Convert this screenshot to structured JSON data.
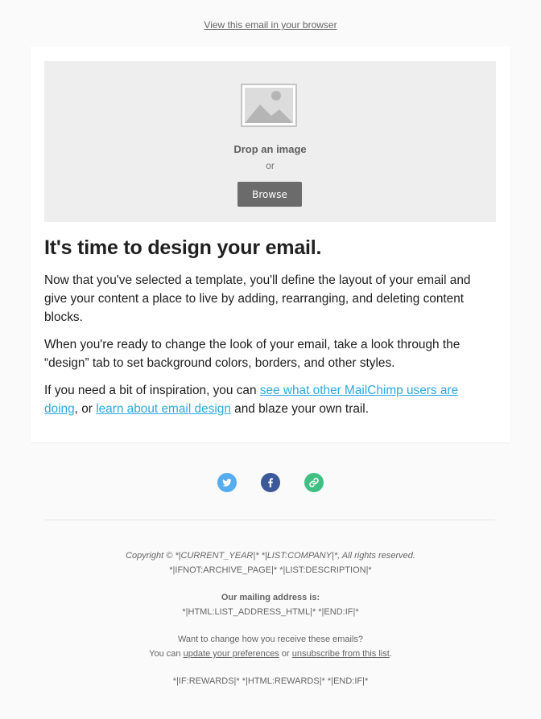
{
  "preheader": {
    "link": "View this email in your browser"
  },
  "dropzone": {
    "icon": "image-placeholder-icon",
    "drop_text": "Drop an image",
    "or_text": "or",
    "browse_label": "Browse"
  },
  "content": {
    "heading": "It's time to design your email.",
    "para1": "Now that you've selected a template, you'll define the layout of your email and give your content a place to live by adding, rearranging, and deleting content blocks.",
    "para2": "When you're ready to change the look of your email, take a look through the “design” tab to set background colors, borders, and other styles.",
    "para3_prefix": "If you need a bit of inspiration, you can ",
    "para3_link1": "see what other MailChimp users are doing",
    "para3_mid": ", or ",
    "para3_link2": "learn about email design",
    "para3_suffix": " and blaze your own trail."
  },
  "social": [
    {
      "name": "twitter-icon",
      "color": "#55acee"
    },
    {
      "name": "facebook-icon",
      "color": "#3b5998"
    },
    {
      "name": "link-icon",
      "color": "#3fbf83"
    }
  ],
  "footer": {
    "copyright": "Copyright © *|CURRENT_YEAR|* *|LIST:COMPANY|*, All rights reserved.",
    "description": "*|IFNOT:ARCHIVE_PAGE|* *|LIST:DESCRIPTION|*",
    "address_heading": "Our mailing address is:",
    "address": "*|HTML:LIST_ADDRESS_HTML|* *|END:IF|*",
    "change_question": "Want to change how you receive these emails?",
    "you_can": "You can ",
    "update_link": "update your preferences",
    "or": " or ",
    "unsubscribe_link": "unsubscribe from this list",
    "period": ".",
    "rewards": "*|IF:REWARDS|* *|HTML:REWARDS|* *|END:IF|*"
  }
}
